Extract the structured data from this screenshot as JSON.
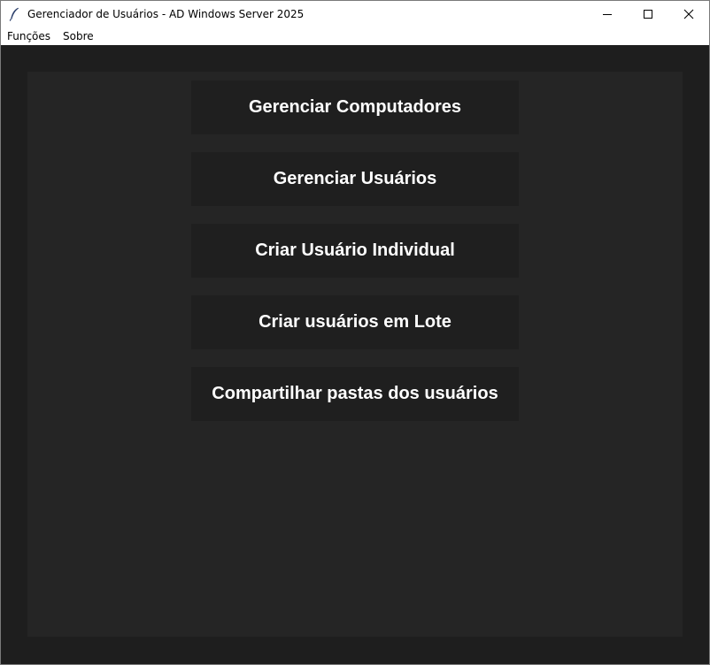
{
  "window": {
    "title": "Gerenciador de Usuários - AD Windows Server 2025",
    "icon": "feather-icon"
  },
  "menu": {
    "items": [
      "Funções",
      "Sobre"
    ]
  },
  "main": {
    "buttons": [
      "Gerenciar Computadores",
      "Gerenciar Usuários",
      "Criar Usuário Individual",
      "Criar usuários em Lote",
      "Compartilhar pastas dos usuários"
    ]
  },
  "colors": {
    "background": "#1e1e1e",
    "panel": "#252525",
    "button": "#1f1f1f",
    "button_text": "#ffffff"
  }
}
